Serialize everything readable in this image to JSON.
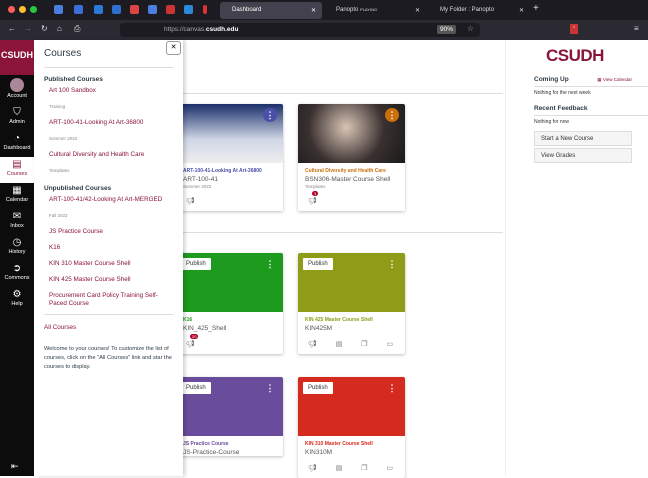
{
  "browser": {
    "tabs": [
      {
        "label": "Dashboard"
      },
      {
        "label": "Panopto",
        "sub": "PLAYING"
      },
      {
        "label": "My Folder : Panopto"
      }
    ],
    "url_prefix": "https://canvas.",
    "url_domain": "csudh.edu",
    "zoom": "90%",
    "ext_badge": "1"
  },
  "nav": {
    "logo": "CSUDH",
    "items": [
      {
        "label": "Account"
      },
      {
        "label": "Admin"
      },
      {
        "label": "Dashboard"
      },
      {
        "label": "Courses"
      },
      {
        "label": "Calendar"
      },
      {
        "label": "Inbox"
      },
      {
        "label": "History"
      },
      {
        "label": "Commons"
      },
      {
        "label": "Help"
      }
    ]
  },
  "tray": {
    "title": "Courses",
    "published_heading": "Published Courses",
    "published": [
      {
        "name": "Art 100 Sandbox",
        "term": "Training"
      },
      {
        "name": "ART-100-41-Looking At Art-36800",
        "term": "Summer 2022"
      },
      {
        "name": "Cultural Diversity and Health Care",
        "term": "Templates"
      }
    ],
    "unpublished_heading": "Unpublished Courses",
    "unpublished": [
      {
        "name": "ART-100-41/42-Looking At Art-MERGED",
        "term": "Fall 2022"
      },
      {
        "name": "JS Practice Course"
      },
      {
        "name": "K16"
      },
      {
        "name": "KIN 310 Master Course Shell"
      },
      {
        "name": "KIN 425 Master Course Shell"
      },
      {
        "name": "Procurement Card Policy Training Self-Paced Course"
      }
    ],
    "all_courses": "All Courses",
    "welcome": "Welcome to your courses! To customize the list of courses, click on the \"All Courses\" link and star the courses to display."
  },
  "cards": [
    {
      "title": "ART-100-41-Looking At Art-36800",
      "code": "ART-100-41",
      "term": "Summer 2022",
      "color": "#4a4fa8"
    },
    {
      "title": "Cultural Diversity and Health Care",
      "code": "BSN306-Master Course Shell",
      "term": "Templates",
      "color": "#c96f0c",
      "badge": "3"
    },
    {
      "title": "K16",
      "code": "KIN_425_Shell",
      "color": "#1e9a1e",
      "publish": "Publish",
      "badge": "20"
    },
    {
      "title": "KIN 425 Master Course Shell",
      "code": "KIN425M",
      "color": "#8e9c17",
      "publish": "Publish"
    },
    {
      "title": "JS Practice Course",
      "code": "JS-Practice-Course",
      "color": "#6a4c9c",
      "publish": "Publish"
    },
    {
      "title": "KIN 310 Master Course Shell",
      "code": "KIN310M",
      "color": "#d52a1e",
      "publish": "Publish"
    }
  ],
  "sidebar": {
    "logo": "CSUDH",
    "coming_up": "Coming Up",
    "view_calendar": "View Calendar",
    "coming_empty": "Nothing for the next week",
    "feedback": "Recent Feedback",
    "feedback_empty": "Nothing for now",
    "start_course": "Start a New Course",
    "view_grades": "View Grades"
  }
}
